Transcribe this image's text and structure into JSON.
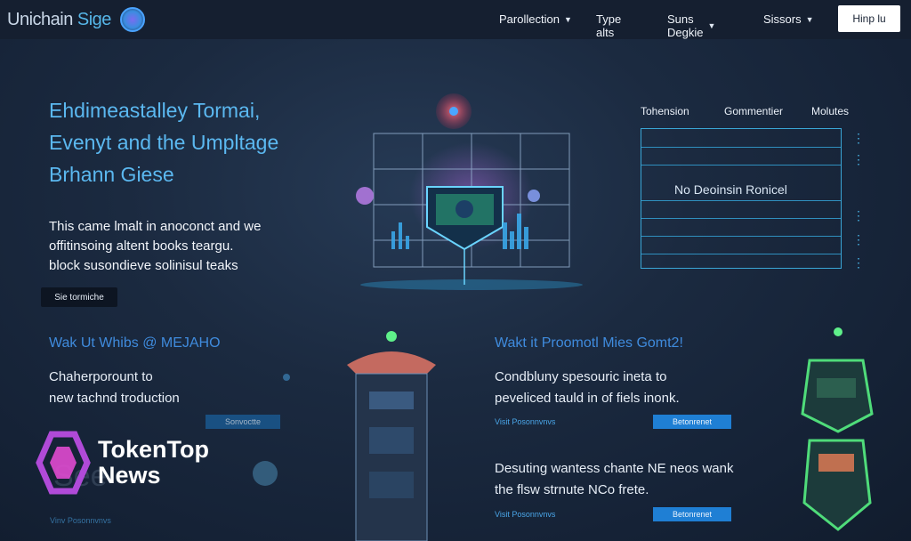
{
  "header": {
    "logo_text_1": "Unichain",
    "logo_text_2": "Sige",
    "nav": [
      {
        "label": "Parollection",
        "caret": true
      },
      {
        "label": "Type alts",
        "caret": false
      },
      {
        "label": "Suns Degkie",
        "caret": true
      },
      {
        "label": "Sissors",
        "caret": true
      }
    ],
    "cta_label": "Hinp lu"
  },
  "hero": {
    "title_lines": [
      "Ehdimeastalley Tormai,",
      "Evenyt and the Umpltage",
      "Brhann Giese"
    ],
    "body_lines": [
      "This came lmalt in anoconct and we",
      "offitinsoing altent books teargu.",
      "block susondieve solinisul teaks"
    ],
    "button_label": "Sie tormiche"
  },
  "panel": {
    "headers": [
      "Tohension",
      "Gommentier",
      "Molutes"
    ],
    "caption": "No Deoinsin Ronicel"
  },
  "sections": {
    "left": {
      "title": "Wak Ut Whibs @ MEJAHO",
      "body_lines": [
        "Chaherporount to",
        "new tachnd troduction"
      ],
      "button_label": "Sonvoctte"
    },
    "right_top": {
      "title": "Wakt it Proomotl Mies Gomt2!",
      "body_lines": [
        "Condbluny spesouric ineta to",
        "peveliced tauld in of fiels inonk."
      ],
      "link": "Visit Posonnvnvs",
      "button_label": "Betonrenet"
    },
    "right_bottom": {
      "body_lines": [
        "Desuting wantess chante NE neos wank",
        "the flsw strnute NCo frete."
      ],
      "link": "Visit Posonnvnvs",
      "button_label": "Betonrenet"
    },
    "left_link": "Vinv Posonnvnvs"
  },
  "watermark": {
    "line1": "TokenTop",
    "line2": "News",
    "faded": "See"
  },
  "colors": {
    "accent": "#5bb8f0",
    "button_blue": "#1f7fd4",
    "header_bg": "#151f30"
  }
}
